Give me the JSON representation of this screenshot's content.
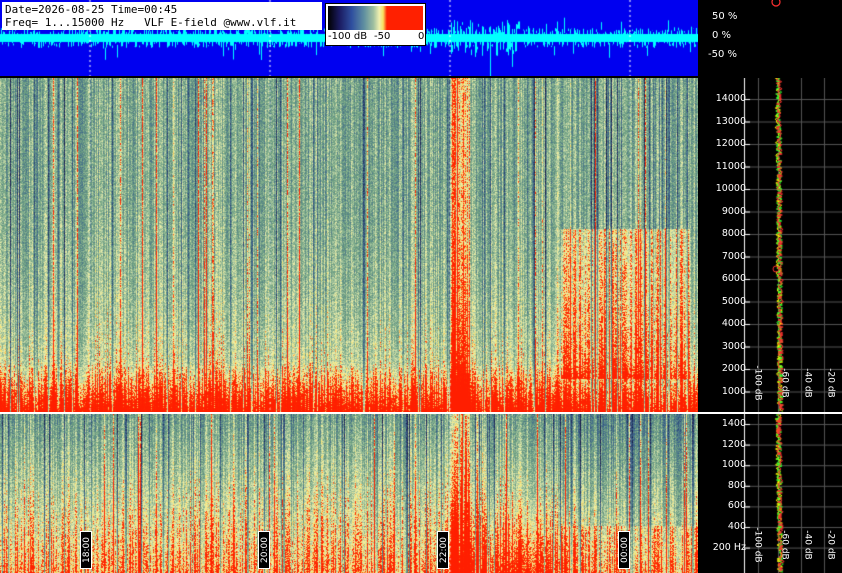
{
  "header": {
    "date_line": "Date=2026-08-25 Time=00:45",
    "freq_line": "Freq= 1...15000 Hz   VLF E-field @www.vlf.it"
  },
  "colorbar": {
    "labels": [
      "-100 dB",
      "-50",
      "0"
    ]
  },
  "waveform_axis": [
    "50 %",
    "0 %",
    "-50 %"
  ],
  "freq_axis_top": [
    "14000",
    "13000",
    "12000",
    "11000",
    "10000",
    "9000",
    "8000",
    "7000",
    "6000",
    "5000",
    "4000",
    "3000",
    "2000",
    "1000"
  ],
  "freq_axis_bottom": [
    "1400",
    "1200",
    "1000",
    "800",
    "600",
    "400",
    "200 Hz"
  ],
  "time_marks": [
    "18:00",
    "20:00",
    "22:00",
    "00:00"
  ],
  "db_labels_top": [
    "-100 dB",
    "-60 dB",
    "-40 dB",
    "-20 dB"
  ],
  "db_labels_bottom": [
    "-100 dB",
    "-60 dB",
    "-40 dB",
    "-20 dB"
  ],
  "colors": {
    "waveform_bg": "#0000f0",
    "waveform": "#00ffff",
    "hot": "#ff2000",
    "profile_green": "#30ff30",
    "profile_yellow": "#ffff00"
  }
}
